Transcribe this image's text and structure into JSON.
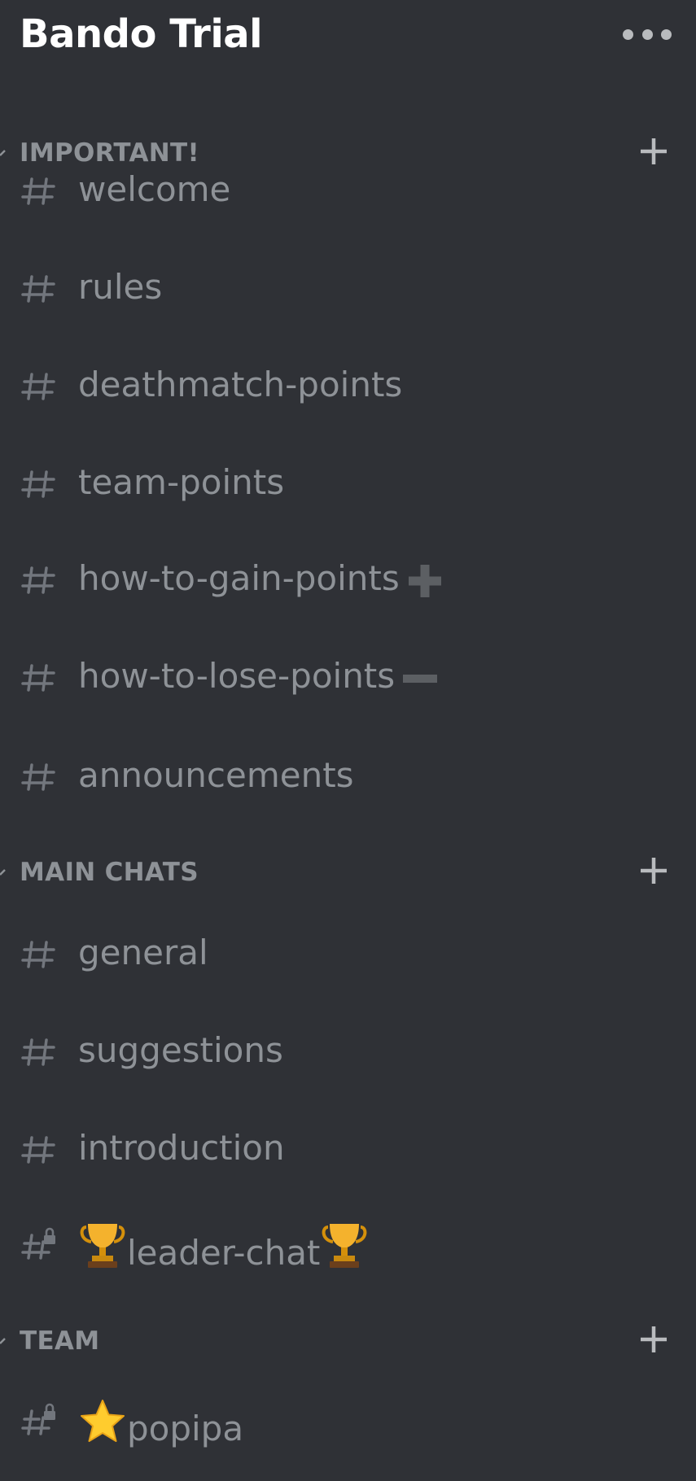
{
  "server": {
    "title": "Bando Trial",
    "more_icon": "more-horizontal-icon"
  },
  "categories": [
    {
      "label": "IMPORTANT!",
      "add_icon": "plus-icon",
      "channels": [
        {
          "name": "welcome",
          "icon": "hash-icon"
        },
        {
          "name": "rules",
          "icon": "hash-icon"
        },
        {
          "name": "deathmatch-points",
          "icon": "hash-icon"
        },
        {
          "name": "team-points",
          "icon": "hash-icon"
        },
        {
          "name": "how-to-gain-points",
          "icon": "hash-icon",
          "suffix_icon": "heavy-plus-icon"
        },
        {
          "name": "how-to-lose-points",
          "icon": "hash-icon",
          "suffix_icon": "heavy-minus-icon"
        },
        {
          "name": "announcements",
          "icon": "hash-icon"
        }
      ]
    },
    {
      "label": "MAIN CHATS",
      "add_icon": "plus-icon",
      "channels": [
        {
          "name": "general",
          "icon": "hash-icon"
        },
        {
          "name": "suggestions",
          "icon": "hash-icon"
        },
        {
          "name": "introduction",
          "icon": "hash-icon"
        },
        {
          "name": "leader-chat",
          "icon": "locked-hash-icon",
          "prefix_emoji": "trophy-icon",
          "suffix_emoji": "trophy-icon"
        }
      ]
    },
    {
      "label": "TEAM",
      "add_icon": "plus-icon",
      "channels": [
        {
          "name": "popipa",
          "icon": "locked-hash-icon",
          "prefix_emoji": "star-icon"
        }
      ]
    }
  ],
  "colors": {
    "background": "#2f3136",
    "title": "#ffffff",
    "muted_text": "#8e9297",
    "icon": "#72767d"
  }
}
